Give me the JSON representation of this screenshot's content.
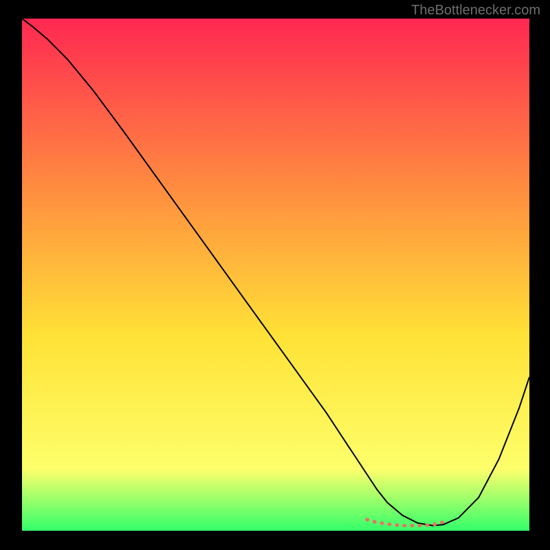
{
  "watermark": "TheBottlenecker.com",
  "chart_data": {
    "type": "line",
    "title": "",
    "xlabel": "",
    "ylabel": "",
    "xlim": [
      0,
      100
    ],
    "ylim": [
      0,
      100
    ],
    "grid": false,
    "legend": false,
    "background_gradient": {
      "top": "#ff2851",
      "mid_upper": "#ff923f",
      "mid": "#ffe236",
      "mid_lower": "#fdff6b",
      "bottom": "#33ff6a"
    },
    "series": [
      {
        "name": "main-curve",
        "color": "#000000",
        "x": [
          0,
          2,
          5,
          9,
          14,
          20,
          28,
          36,
          44,
          52,
          60,
          64,
          68,
          70,
          72,
          75,
          78,
          81,
          83,
          86,
          90,
          94,
          98,
          100
        ],
        "y": [
          100,
          98.5,
          96,
          92,
          86,
          78,
          67,
          56,
          45,
          34,
          23,
          17,
          11,
          8,
          5.5,
          3,
          1.5,
          1,
          1.2,
          2.5,
          6.5,
          14,
          24,
          30
        ]
      },
      {
        "name": "highlight-flat-bottom",
        "color": "#ec7063",
        "style": "dotted",
        "x": [
          68,
          70,
          72,
          73,
          74,
          75,
          76,
          77,
          78,
          79,
          80,
          81,
          82,
          83,
          84
        ],
        "y": [
          2.2,
          1.6,
          1.3,
          1.2,
          1.1,
          1.0,
          1.0,
          1.0,
          1.0,
          1.0,
          1.1,
          1.2,
          1.4,
          1.7,
          2.1
        ]
      }
    ]
  }
}
